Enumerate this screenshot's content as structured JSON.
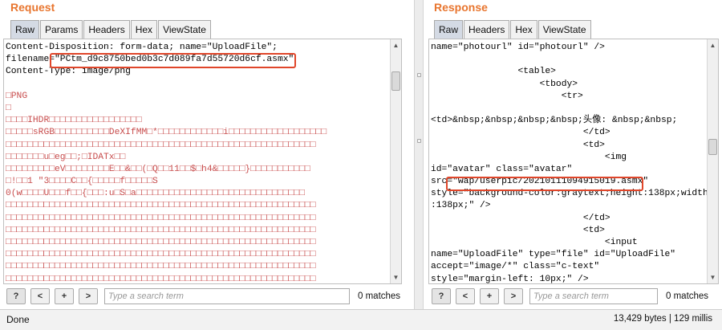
{
  "request": {
    "title": "Request",
    "tabs": [
      "Raw",
      "Params",
      "Headers",
      "Hex",
      "ViewState"
    ],
    "active_tab": "Raw",
    "lines": [
      "Content-Disposition: form-data; name=\"UploadFile\";",
      "filename=\"PCtm_d9c8750bed0b3c7d089fa7d55720d6cf.asmx\"",
      "Content-Type: image/png",
      "",
      "□PNG",
      "□",
      "□□□□IHDR□□□□□□□□□□□□□□□□□",
      "□□□□□sRGB□□□□□□□□□□DeXIfMM□*□□□□□□□□□□□□i□□□□□□□□□□□□□□□□□□",
      "□□□□□□□□□□□□□□□□□□□□□□□□□□□□□□□□□□□□□□□□□□□□□□□□□□□□□□□□□",
      "□□□□□□□u□eg□□;□IDATx□□",
      "□□□□□□□□□eV□□□□□□□□E□□&□□(□Q□□11□□$□h4&□□□□□}□□□□□□□□□□□",
      "□!□□1 \"3□□□□C□□{□□□□□f□□□□□S",
      "0(w□□□□U□□□f□□{□□□:u□S□a□□□□□□□□□□□□□□□□□□□□□□□□□□□□□□□",
      "□□□□□□□□□□□□□□□□□□□□□□□□□□□□□□□□□□□□□□□□□□□□□□□□□□□□□□□□□",
      "□□□□□□□□□□□□□□□□□□□□□□□□□□□□□□□□□□□□□□□□□□□□□□□□□□□□□□□□□",
      "□□□□□□□□□□□□□□□□□□□□□□□□□□□□□□□□□□□□□□□□□□□□□□□□□□□□□□□□□",
      "□□□□□□□□□□□□□□□□□□□□□□□□□□□□□□□□□□□□□□□□□□□□□□□□□□□□□□□□□",
      "□□□□□□□□□□□□□□□□□□□□□□□□□□□□□□□□□□□□□□□□□□□□□□□□□□□□□□□□□",
      "□□□□□□□□□□□□□□□□□□□□□□□□□□□□□□□□□□□□□□□□□□□□□□□□□□□□□□□□□",
      "□□□□□□□□□□□□□□□□□□□□□□□□□□□□□□□□□□□□□□□□□□□□□□□□□□□□□□□□□"
    ],
    "search_placeholder": "Type a search term",
    "matches": "0 matches"
  },
  "response": {
    "title": "Response",
    "tabs": [
      "Raw",
      "Headers",
      "Hex",
      "ViewState"
    ],
    "active_tab": "Raw",
    "lines": [
      "name=\"photourl\" id=\"photourl\" />",
      "",
      "                <table>",
      "                    <tbody>",
      "                        <tr>",
      "",
      "<td>&nbsp;&nbsp;&nbsp;&nbsp;头像: &nbsp;&nbsp;",
      "                            </td>",
      "                            <td>",
      "                                <img",
      "id=\"avatar\" class=\"avatar\"",
      "src=\"wap/userpic/20210111094915019.asmx\"",
      "style=\"background-color:graytext;height:138px;width",
      ":138px;\" />",
      "                            </td>",
      "                            <td>",
      "                                <input",
      "name=\"UploadFile\" type=\"file\" id=\"UploadFile\"",
      "accept=\"image/*\" class=\"c-text\"",
      "style=\"margin-left: 10px;\" />"
    ],
    "search_placeholder": "Type a search term",
    "matches": "0 matches"
  },
  "search_buttons": {
    "help": "?",
    "prev": "<",
    "add": "+",
    "next": ">"
  },
  "status": {
    "left": "Done",
    "right": "13,429 bytes | 129 millis"
  },
  "colors": {
    "title": "#e8752e",
    "highlight_box": "#e0462a",
    "binary_text": "#c84d4d",
    "active_tab": "#d4dae4"
  }
}
